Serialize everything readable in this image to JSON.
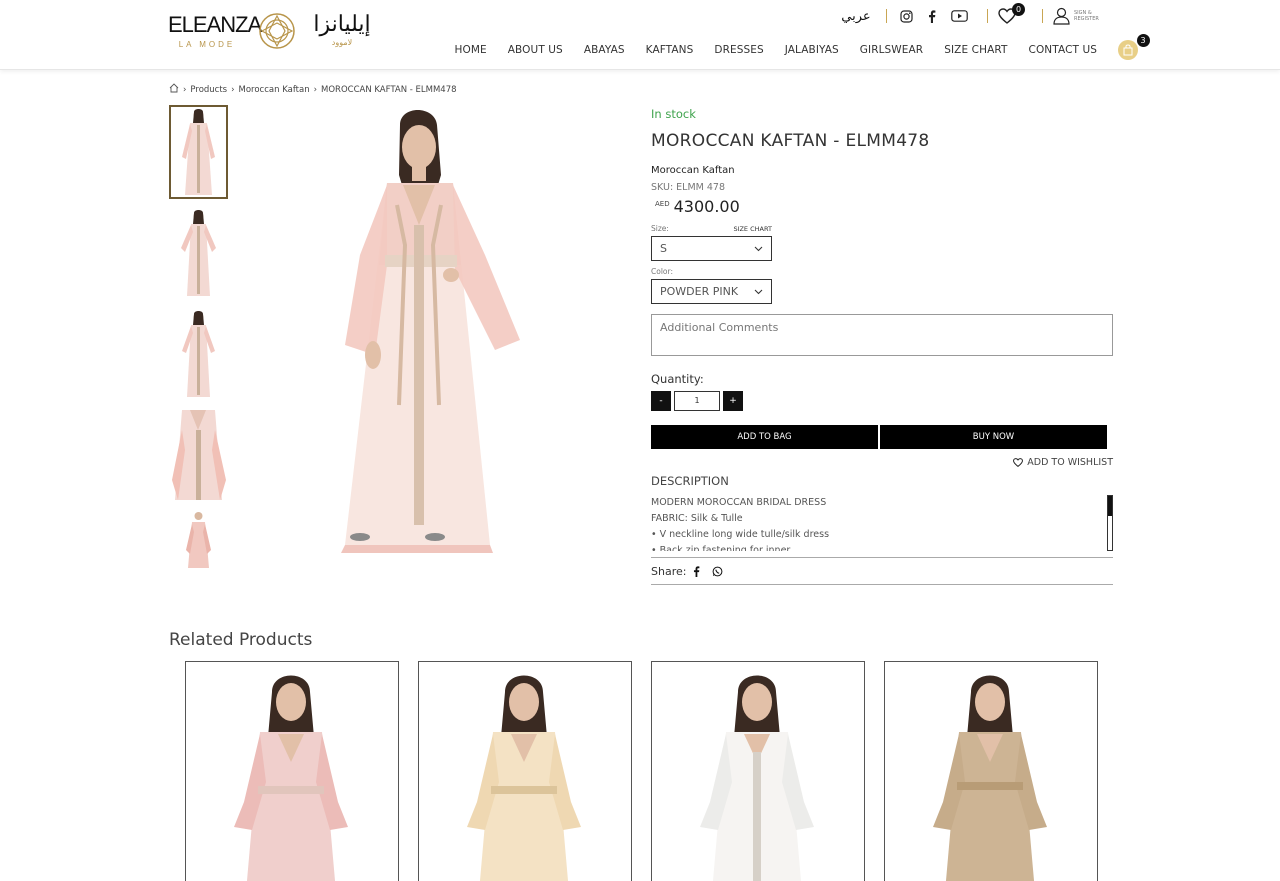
{
  "brand": {
    "name": "ELEANZA",
    "tagline": "LA MODE",
    "name_ar": "إيليانزا",
    "tagline_ar": "لاموود"
  },
  "topbar": {
    "language": "عربي",
    "wishlist_count": "0",
    "account_label": "SIGN & REGISTER"
  },
  "nav": {
    "items": [
      "HOME",
      "ABOUT US",
      "ABAYAS",
      "KAFTANS",
      "DRESSES",
      "JALABIYAS",
      "GIRLSWEAR",
      "SIZE CHART",
      "CONTACT US"
    ],
    "cart_count": "3"
  },
  "breadcrumb": [
    "Products",
    "Moroccan Kaftan",
    "MOROCCAN KAFTAN - ELMM478"
  ],
  "product": {
    "stock": "In stock",
    "title": "MOROCCAN KAFTAN - ELMM478",
    "category": "Moroccan Kaftan",
    "sku": "SKU: ELMM 478",
    "currency": "AED",
    "price": "4300.00",
    "size_label": "Size:",
    "size_chart": "SIZE CHART",
    "size_value": "S",
    "color_label": "Color:",
    "color_value": "POWDER PINK",
    "comments_placeholder": "Additional Comments",
    "quantity_label": "Quantity:",
    "quantity": "1",
    "minus": "-",
    "plus": "+",
    "add_to_bag": "ADD TO BAG",
    "buy_now": "BUY NOW",
    "wishlist": "ADD TO WISHLIST",
    "description_heading": "DESCRIPTION",
    "description": [
      "MODERN MOROCCAN BRIDAL DRESS",
      "FABRIC: Silk & Tulle",
      "• V neckline long wide tulle/silk dress",
      "• Back zip fastening for inner"
    ],
    "share_label": "Share:"
  },
  "related": {
    "title": "Related Products"
  },
  "colors": {
    "stock": "#3fa34d",
    "gold": "#c9a654",
    "dark": "#111111"
  }
}
